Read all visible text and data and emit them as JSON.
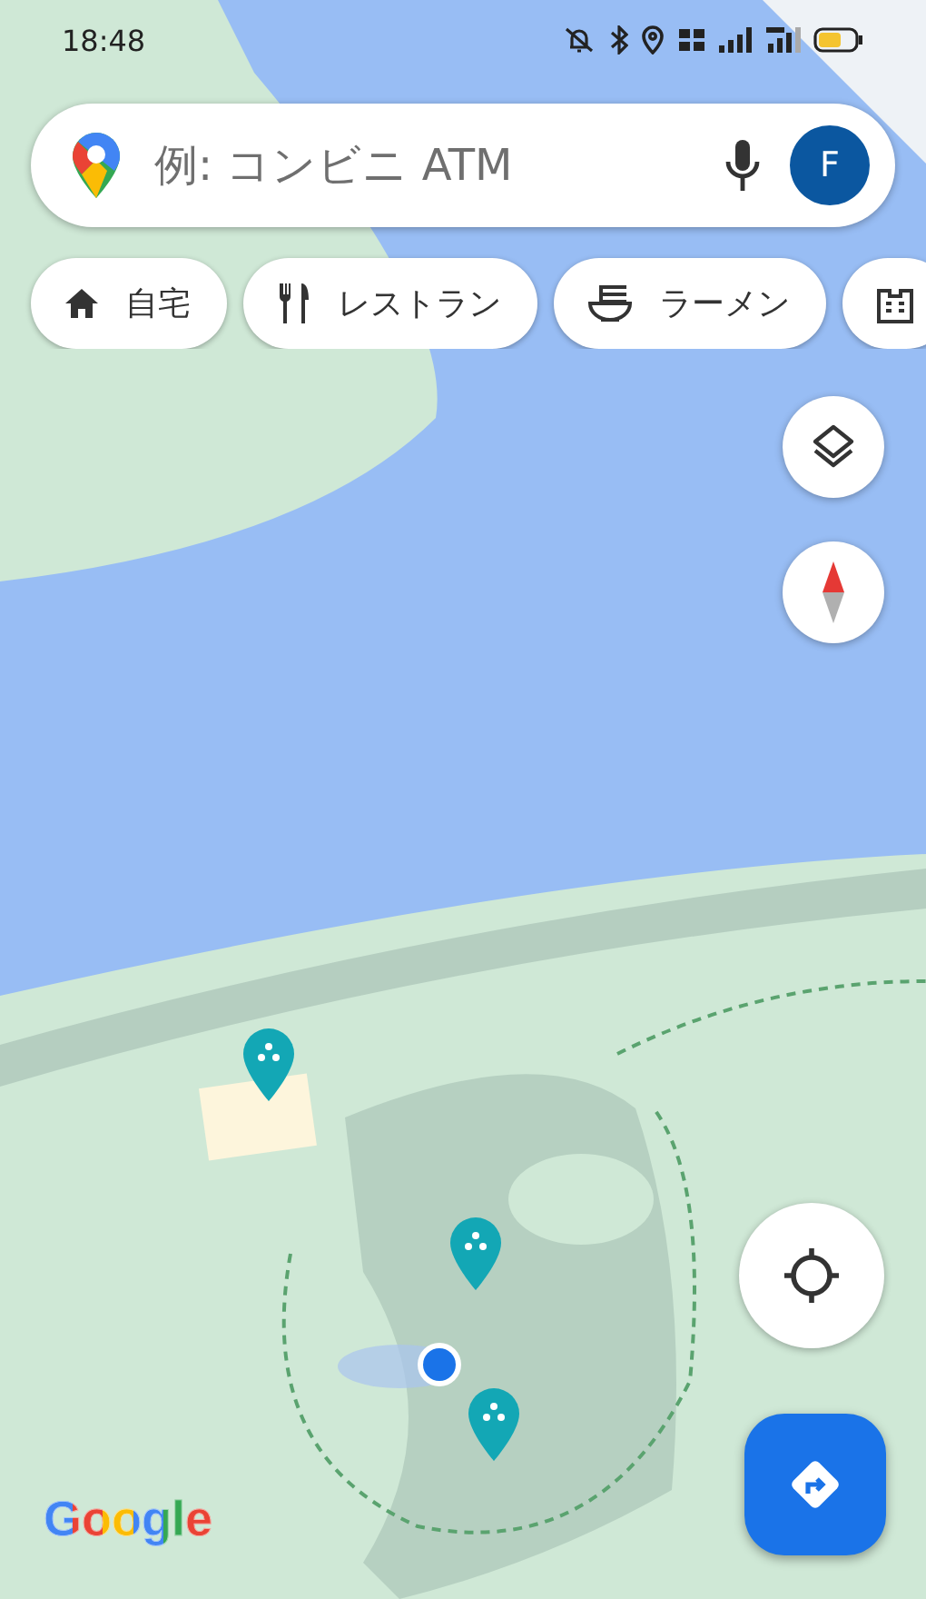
{
  "status_bar": {
    "time": "18:48"
  },
  "search": {
    "placeholder": "例: コンビニ ATM",
    "avatar": "F"
  },
  "chips": [
    {
      "kind": "home",
      "label": "自宅"
    },
    {
      "kind": "restaurant",
      "label": "レストラン"
    },
    {
      "kind": "ramen",
      "label": "ラーメン"
    },
    {
      "kind": "hotel"
    }
  ],
  "logo": "Google"
}
